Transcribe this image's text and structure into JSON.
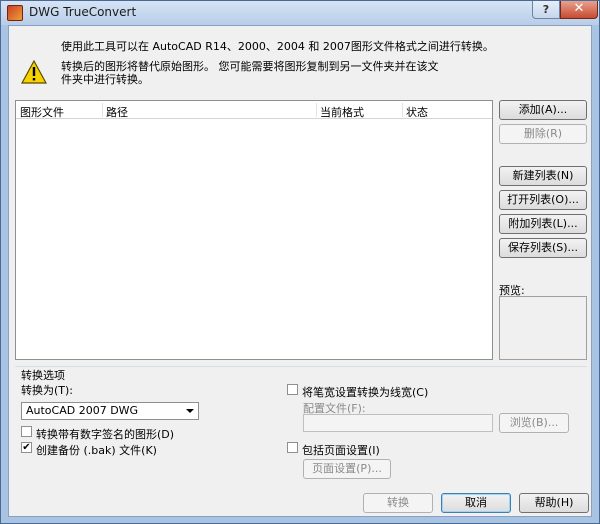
{
  "window": {
    "title": "DWG TrueConvert",
    "help_label": "?",
    "close_label": "✕"
  },
  "info": {
    "line1": "使用此工具可以在 AutoCAD R14、2000、2004 和 2007图形文件格式之间进行转换。",
    "line2": "转换后的图形将替代原始图形。 您可能需要将图形复制到另一文件夹并在该文件夹中进行转换。"
  },
  "file_list": {
    "columns": [
      "图形文件",
      "路径",
      "当前格式",
      "状态"
    ],
    "rows": []
  },
  "side_buttons": {
    "add": "添加(A)...",
    "remove": "删除(R)",
    "new_list": "新建列表(N)",
    "open_list": "打开列表(O)...",
    "append_list": "附加列表(L)...",
    "save_list": "保存列表(S)..."
  },
  "preview": {
    "label": "预览:"
  },
  "options": {
    "group_title": "转换选项",
    "convert_to_label": "转换为(T):",
    "convert_to_value": "AutoCAD 2007 DWG",
    "convert_signed_label": "转换带有数字签名的图形(D)",
    "convert_signed_checked": false,
    "create_backup_label": "创建备份 (.bak) 文件(K)",
    "create_backup_checked": true,
    "pen_width_label": "将笔宽设置转换为线宽(C)",
    "pen_width_checked": false,
    "config_file_label": "配置文件(F):",
    "config_file_value": "",
    "browse_label": "浏览(B)...",
    "page_setup_label": "包括页面设置(I)",
    "page_setup_checked": false,
    "page_setup_button": "页面设置(P)..."
  },
  "footer": {
    "convert": "转换",
    "cancel": "取消",
    "help": "帮助(H)"
  }
}
